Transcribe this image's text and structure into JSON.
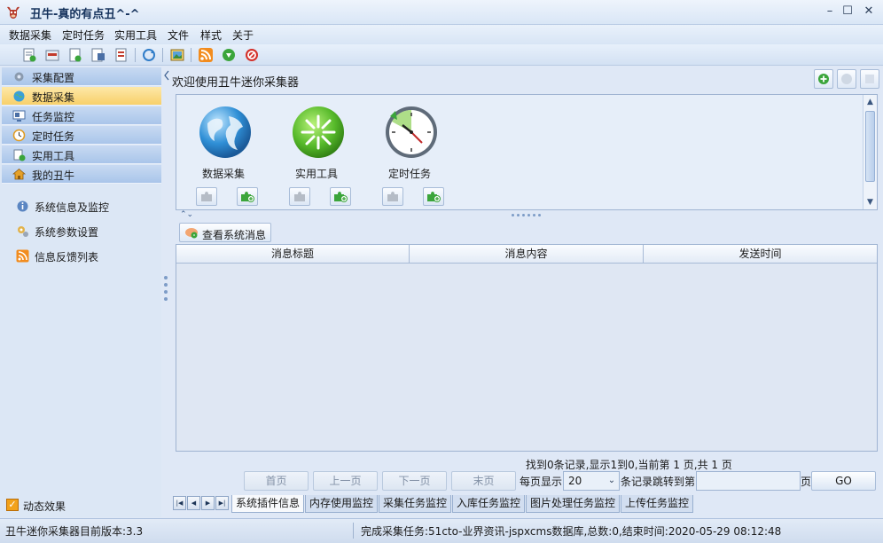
{
  "window": {
    "title": "丑牛-真的有点丑^-^",
    "minimize": "–",
    "maximize": "☐",
    "close": "✕"
  },
  "menu": [
    "数据采集",
    "定时任务",
    "实用工具",
    "文件",
    "样式",
    "关于"
  ],
  "toolbar_icons": [
    "new-task-icon",
    "open-icon",
    "save-icon",
    "export-icon",
    "import-icon",
    "refresh-icon",
    "image-icon",
    "rss-icon",
    "down-arrow-icon",
    "stop-icon"
  ],
  "sidebar": {
    "nav": [
      {
        "label": "采集配置",
        "icon": "gear-icon"
      },
      {
        "label": "数据采集",
        "icon": "globe-icon"
      },
      {
        "label": "任务监控",
        "icon": "monitor-icon"
      },
      {
        "label": "定时任务",
        "icon": "clock-icon"
      },
      {
        "label": "实用工具",
        "icon": "tools-icon"
      },
      {
        "label": "我的丑牛",
        "icon": "home-icon"
      }
    ],
    "links": [
      {
        "label": "系统信息及监控",
        "icon": "info-icon"
      },
      {
        "label": "系统参数设置",
        "icon": "settings-icon"
      },
      {
        "label": "信息反馈列表",
        "icon": "rss-icon"
      }
    ],
    "effect_label": "动态效果",
    "effect_checked": true
  },
  "main": {
    "welcome": "欢迎使用丑牛迷你采集器",
    "modules": [
      {
        "label": "数据采集",
        "icon": "globe-icon"
      },
      {
        "label": "实用工具",
        "icon": "starburst-icon"
      },
      {
        "label": "定时任务",
        "icon": "clock-icon"
      }
    ],
    "sysmsg_button": "查看系统消息",
    "columns": [
      "消息标题",
      "消息内容",
      "发送时间"
    ],
    "pager": {
      "info": "找到0条记录,显示1到0,当前第 1 页,共 1 页",
      "first": "首页",
      "prev": "上一页",
      "next": "下一页",
      "last": "末页",
      "per_page_label": "每页显示",
      "per_page_value": "20",
      "jump_label": "条记录跳转到第",
      "page_suffix": "页",
      "go": "GO"
    },
    "tabs": [
      "系统插件信息",
      "内存使用监控",
      "采集任务监控",
      "入库任务监控",
      "图片处理任务监控",
      "上传任务监控"
    ]
  },
  "status": {
    "left": "丑牛迷你采集器目前版本:3.3",
    "right": "完成采集任务:51cto-业界资讯-jspxcms数据库,总数:0,结束时间:2020-05-29 08:12:48"
  }
}
